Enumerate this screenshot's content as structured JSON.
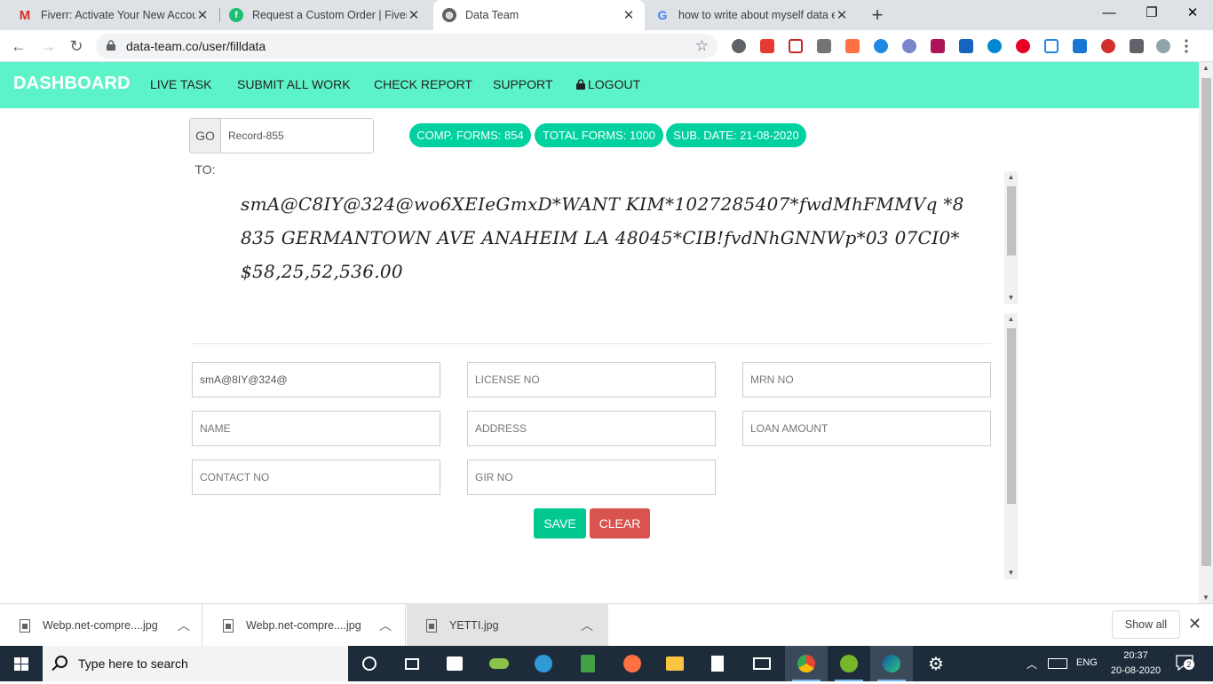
{
  "browser": {
    "tabs": [
      {
        "title": "Fiverr: Activate Your New Account",
        "icon": "gmail-icon"
      },
      {
        "title": "Request a Custom Order | Fiverr",
        "icon": "fiverr-icon"
      },
      {
        "title": "Data Team",
        "icon": "globe-icon"
      },
      {
        "title": "how to write about myself data e",
        "icon": "google-icon"
      }
    ],
    "url": "data-team.co/user/filldata"
  },
  "nav": {
    "brand": "DASHBOARD",
    "links": [
      "LIVE TASK",
      "SUBMIT ALL WORK",
      "CHECK REPORT",
      "SUPPORT",
      "LOGOUT"
    ]
  },
  "goto": {
    "label": "GO TO:",
    "value": "Record-855"
  },
  "stats": {
    "completed": "COMP. FORMS: 854",
    "total": "TOTAL FORMS: 1000",
    "date": "SUB. DATE: 21-08-2020"
  },
  "record_text": "smA@C8IY@324@wo6XEIeGmxD*WANT KIM*1027285407*fwdMhFMMVq *8835 GERMANTOWN AVE ANAHEIM LA 48045*CIB!fvdNhGNNWp*03 07CI0*$58,25,52,536.00",
  "form": {
    "field1_value": "smA@8IY@324@",
    "placeholders": {
      "license": "LICENSE NO",
      "mrn": "MRN NO",
      "name": "NAME",
      "address": "ADDRESS",
      "loan": "LOAN AMOUNT",
      "contact": "CONTACT NO",
      "gir": "GIR NO"
    },
    "save": "SAVE",
    "clear": "CLEAR"
  },
  "downloads": {
    "items": [
      "Webp.net-compre....jpg",
      "Webp.net-compre....jpg",
      "YETTI.jpg"
    ],
    "show_all": "Show all"
  },
  "taskbar": {
    "search_placeholder": "Type here to search",
    "lang": "ENG",
    "time": "20:37",
    "date": "20-08-2020",
    "notifications": "2"
  },
  "colors": {
    "nav_bg": "#5df3c9",
    "badge": "#00d19f",
    "save": "#00c88f",
    "clear": "#d9534f"
  }
}
